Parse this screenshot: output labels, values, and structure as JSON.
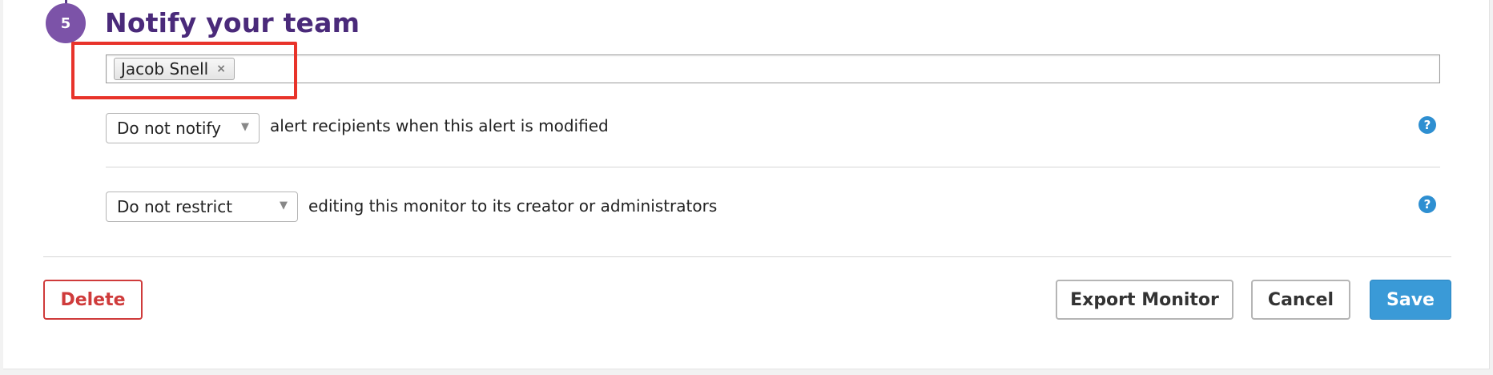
{
  "step": {
    "number": "5",
    "title": "Notify your team"
  },
  "recipients": {
    "tags": [
      {
        "label": "Jacob Snell",
        "remove": "×"
      }
    ]
  },
  "notify_row": {
    "select_value": "Do not notify",
    "arrow": "▼",
    "text": "alert recipients when this alert is modified",
    "help": "?"
  },
  "restrict_row": {
    "select_value": "Do not restrict",
    "arrow": "▼",
    "text": "editing this monitor to its creator or administrators",
    "help": "?"
  },
  "actions": {
    "delete_label": "Delete",
    "export_label": "Export Monitor",
    "cancel_label": "Cancel",
    "save_label": "Save"
  },
  "colors": {
    "accent_purple": "#4a2a7a",
    "badge_purple": "#7c53a8",
    "highlight_red": "#e8332a",
    "delete_red": "#cf3b3b",
    "save_blue": "#3a9ad7",
    "help_blue": "#2e8fd1"
  },
  "icons": {
    "help": "question-circle-icon",
    "dropdown": "chevron-down-icon",
    "remove_tag": "close-icon"
  }
}
